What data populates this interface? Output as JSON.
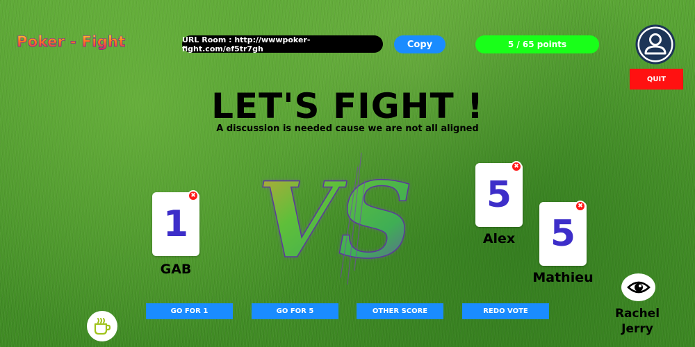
{
  "app": {
    "logo_text": "Poker - Fight"
  },
  "header": {
    "url_label": "URL Room : http://wwwpoker-fight.com/ef5tr7gh",
    "copy_label": "Copy",
    "points_label": "5 / 65 points",
    "quit_label": "QUIT",
    "avatar_icon": "user-circle-icon"
  },
  "main": {
    "headline": "LET'S FIGHT !",
    "subline": "A discussion is needed cause we are not all aligned",
    "vs_label": "VS"
  },
  "players": [
    {
      "name": "GAB",
      "vote": "1"
    },
    {
      "name": "Alex",
      "vote": "5"
    },
    {
      "name": "Mathieu",
      "vote": "5"
    }
  ],
  "actions": {
    "go_for_1": "GO FOR 1",
    "go_for_5": "GO FOR 5",
    "other_score": "OTHER SCORE",
    "redo_vote": "REDO VOTE"
  },
  "spectators": {
    "icon": "eye-icon",
    "names": [
      "Rachel",
      "Jerry"
    ]
  },
  "misc": {
    "coffee_icon": "coffee-cup-icon",
    "remove_glyph": "✖"
  },
  "colors": {
    "accent_blue": "#1a8cff",
    "points_green": "#19ff19",
    "quit_red": "#ff1111",
    "card_digit": "#3d2ec9"
  }
}
